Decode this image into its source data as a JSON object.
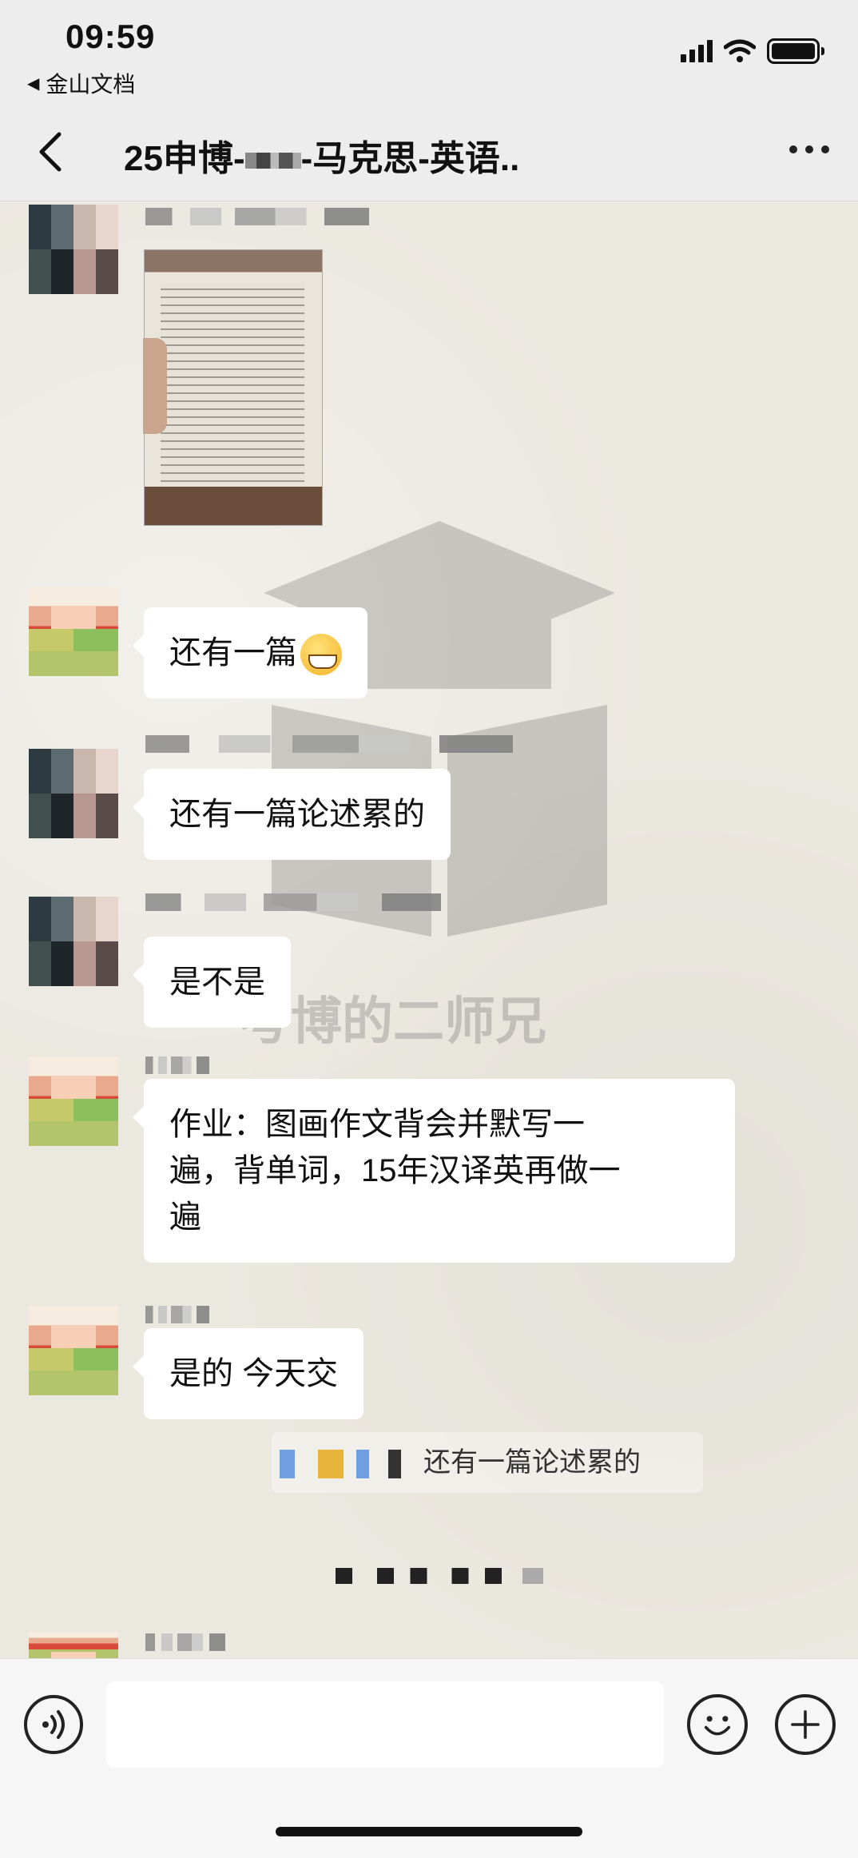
{
  "status_bar": {
    "time": "09:59",
    "back_app": "金山文档",
    "icons": [
      "signal-icon",
      "wifi-icon",
      "battery-icon"
    ]
  },
  "nav": {
    "title_prefix": "25申博-",
    "title_suffix": "-马克思-英语..",
    "more_icon": "more-dots-icon",
    "back_icon": "chevron-left-icon"
  },
  "chat": {
    "watermark_text": "考博的二师兄",
    "messages": [
      {
        "type": "image",
        "sender": "user-a"
      },
      {
        "type": "text",
        "sender": "user-b",
        "text": "还有一篇",
        "emoji": "grin-emoji"
      },
      {
        "type": "text",
        "sender": "user-a",
        "text": "还有一篇论述累的"
      },
      {
        "type": "text",
        "sender": "user-a",
        "text": "是不是"
      },
      {
        "type": "text",
        "sender": "user-b",
        "lines": [
          "作业：图画作文背会并默写一",
          "遍，背单词，15年汉译英再做一",
          "遍"
        ]
      },
      {
        "type": "text",
        "sender": "user-b",
        "text": "是的 今天交"
      }
    ],
    "quote_text": "还有一篇论述累的"
  },
  "input_bar": {
    "placeholder": "",
    "icons": [
      "voice-icon",
      "emoji-face-icon",
      "plus-icon"
    ]
  }
}
